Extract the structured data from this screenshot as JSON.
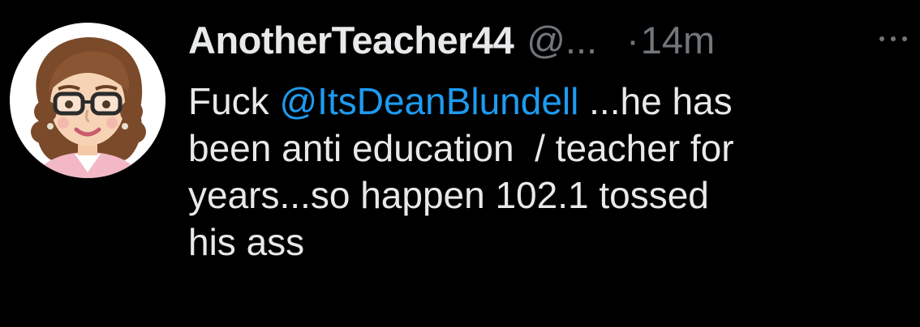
{
  "tweet": {
    "display_name": "AnotherTeacher44",
    "handle": "@...",
    "separator": "·",
    "time": "14m",
    "more_icon": "more-horizontal-icon",
    "avatar_icon": "cartoon-teacher-avatar",
    "body": {
      "line1_prefix": "Fuck ",
      "mention": "@ItsDeanBlundell",
      "line1_suffix": " ...he has",
      "line2": "been anti education  / teacher for",
      "line3": "years...so happen 102.1 tossed",
      "line4": "his ass"
    }
  },
  "colors": {
    "background": "#000000",
    "text": "#e7e9ea",
    "secondary": "#71767b",
    "mention": "#1d9bf0"
  }
}
